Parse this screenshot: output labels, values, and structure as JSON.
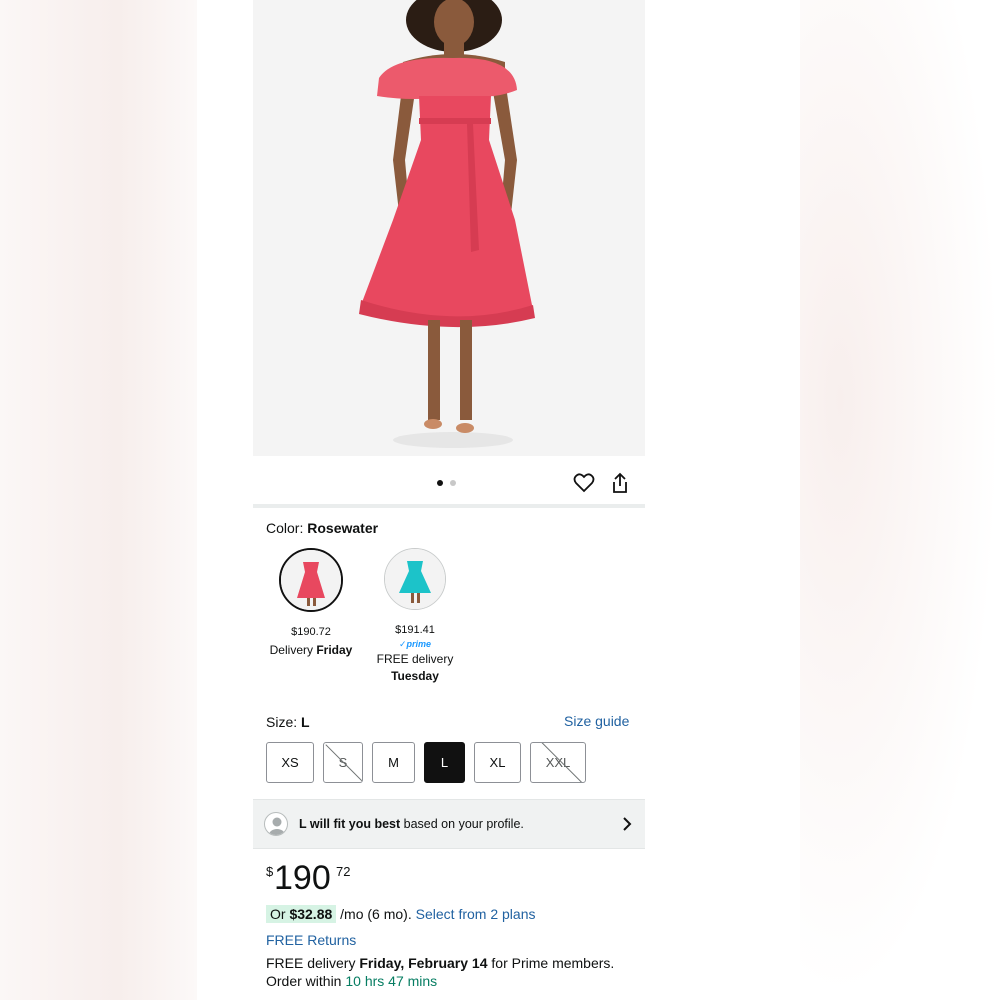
{
  "gallery": {
    "dot_count": 2,
    "active_index": 0
  },
  "color": {
    "label": "Color:",
    "selected": "Rosewater"
  },
  "swatches": [
    {
      "price": "$190.72",
      "delivery_prefix": "Delivery",
      "delivery_day": "Friday",
      "prime": "",
      "color": "#e8485f"
    },
    {
      "price": "$191.41",
      "delivery_prefix": "FREE delivery",
      "delivery_day": "Tuesday",
      "prime": "✓prime",
      "color": "#1cc3c9"
    }
  ],
  "size": {
    "label": "Size:",
    "selected": "L",
    "guide_link": "Size guide",
    "options": [
      {
        "label": "XS",
        "state": "available"
      },
      {
        "label": "S",
        "state": "unavailable"
      },
      {
        "label": "M",
        "state": "available"
      },
      {
        "label": "L",
        "state": "selected"
      },
      {
        "label": "XL",
        "state": "available"
      },
      {
        "label": "XXL",
        "state": "unavailable"
      }
    ]
  },
  "fit": {
    "bold": "L will fit you best",
    "rest": "based on your profile."
  },
  "price": {
    "symbol": "$",
    "whole": "190",
    "fraction": "72"
  },
  "finance": {
    "prefix": "Or",
    "amount": "$32.88",
    "term": "/mo (6 mo).",
    "plans_link": "Select from 2 plans"
  },
  "returns": {
    "label": "FREE Returns"
  },
  "delivery": {
    "prefix": "FREE delivery",
    "date": "Friday, February 14",
    "suffix": "for Prime members.",
    "order_prefix": "Order within",
    "countdown": "10 hrs 47 mins"
  },
  "colors": {
    "link": "#2162a1",
    "accent_green": "#067d62",
    "dress": "#e8485f"
  }
}
